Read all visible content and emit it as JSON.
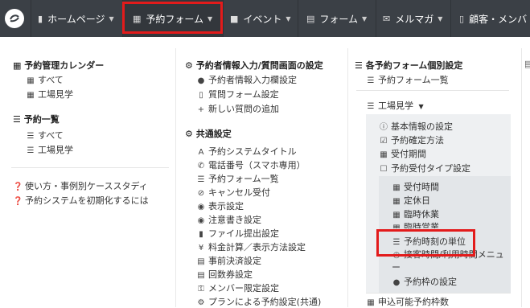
{
  "nav": {
    "items": [
      {
        "icon": "file-icon",
        "label": "ホームページ"
      },
      {
        "icon": "calendar-icon",
        "label": "予約フォーム"
      },
      {
        "icon": "speech-icon",
        "label": "イベント"
      },
      {
        "icon": "form-icon",
        "label": "フォーム"
      },
      {
        "icon": "envelope-icon",
        "label": "メルマガ"
      },
      {
        "icon": "book-icon",
        "label": "顧客・メンバ"
      }
    ]
  },
  "col1": {
    "calendar_title": "予約管理カレンダー",
    "calendar_items": [
      "すべて",
      "工場見学"
    ],
    "list_title": "予約一覧",
    "list_items": [
      "すべて",
      "工場見学"
    ],
    "help1": "使い方・事例別ケーススタディ",
    "help2": "予約システムを初期化するには"
  },
  "col2": {
    "input_title": "予約者情報入力/質問画面の設定",
    "input_items": [
      "予約者情報入力欄設定",
      "質問フォーム設定",
      "新しい質問の追加"
    ],
    "common_title": "共通設定",
    "common_items": [
      "予約システムタイトル",
      "電話番号（スマホ専用）",
      "予約フォーム一覧",
      "キャンセル受付",
      "表示設定",
      "注意書き設定",
      "ファイル提出設定",
      "料金計算／表示方法設定",
      "事前決済設定",
      "回数券設定",
      "メンバー限定設定",
      "プランによる予約設定(共通)"
    ]
  },
  "col3": {
    "title": "各予約フォーム個別設定",
    "list_link": "予約フォーム一覧",
    "form_name": "工場見学",
    "form_items": [
      "基本情報の設定",
      "予約確定方法",
      "受付期間",
      "予約受付タイプ設定"
    ],
    "type_items": [
      "受付時間",
      "定休日",
      "臨時休業",
      "臨時営業",
      "予約時刻の単位",
      "接客時間/利用時間メニュー",
      "予約枠の設定"
    ],
    "bottom_item": "申込可能予約枠数"
  },
  "colors": {
    "topbar": "#3b4046",
    "highlight": "#e31b1b"
  }
}
